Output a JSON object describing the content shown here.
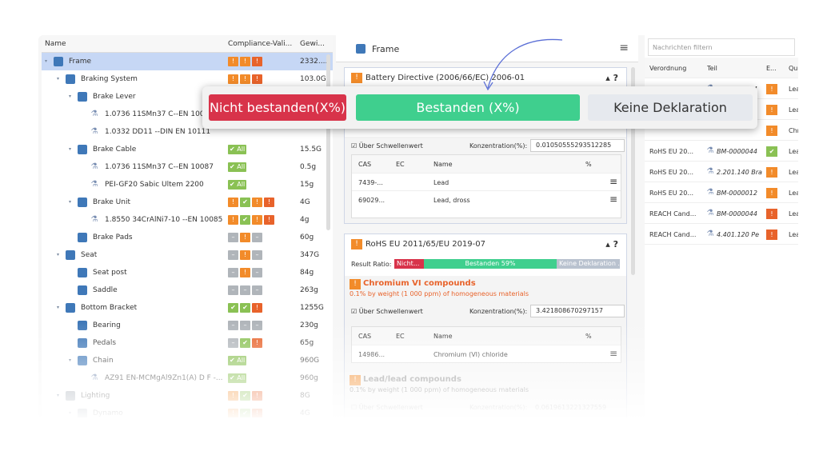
{
  "tree": {
    "headers": {
      "name": "Name",
      "compliance": "Compliance-Vali...",
      "weight": "Gewi..."
    },
    "rows": [
      {
        "label": "Frame",
        "weight": "2332....",
        "chips": [
          {
            "t": "w",
            "s": "!"
          },
          {
            "t": "w",
            "s": "!"
          },
          {
            "t": "e",
            "s": "!"
          }
        ],
        "indent": 0,
        "icon": "cube",
        "exp": "▾",
        "sel": true
      },
      {
        "label": "Braking System",
        "weight": "103.0G",
        "chips": [
          {
            "t": "w",
            "s": "!"
          },
          {
            "t": "w",
            "s": "!"
          },
          {
            "t": "e",
            "s": "!"
          }
        ],
        "indent": 1,
        "icon": "cube",
        "exp": "▾"
      },
      {
        "label": "Brake Lever",
        "weight": "",
        "chips": [],
        "indent": 2,
        "icon": "cube",
        "exp": "▾"
      },
      {
        "label": "1.0736 11SMn37 C--EN 10087",
        "weight": "",
        "chips": [],
        "indent": 3,
        "icon": "flask"
      },
      {
        "label": "1.0332 DD11 --DIN EN 10111",
        "weight": "",
        "chips": [],
        "indent": 3,
        "icon": "flask"
      },
      {
        "label": "Brake Cable",
        "weight": "15.5G",
        "chips": [
          {
            "t": "g",
            "s": "✔ All"
          }
        ],
        "indent": 2,
        "icon": "cube",
        "exp": "▾"
      },
      {
        "label": "1.0736 11SMn37 C--EN 10087",
        "weight": "0.5g",
        "chips": [
          {
            "t": "g",
            "s": "✔ All"
          }
        ],
        "indent": 3,
        "icon": "flask"
      },
      {
        "label": "PEI-GF20 Sabic Ultem 2200",
        "weight": "15g",
        "chips": [
          {
            "t": "g",
            "s": "✔ All"
          }
        ],
        "indent": 3,
        "icon": "flask"
      },
      {
        "label": "Brake Unit",
        "weight": "4G",
        "chips": [
          {
            "t": "w",
            "s": "!"
          },
          {
            "t": "g",
            "s": "✔"
          },
          {
            "t": "w",
            "s": "!"
          },
          {
            "t": "e",
            "s": "!"
          }
        ],
        "indent": 2,
        "icon": "cube",
        "exp": "▾"
      },
      {
        "label": "1.8550 34CrAlNi7-10 --EN 10085",
        "weight": "4g",
        "chips": [
          {
            "t": "w",
            "s": "!"
          },
          {
            "t": "g",
            "s": "✔"
          },
          {
            "t": "w",
            "s": "!"
          },
          {
            "t": "e",
            "s": "!"
          }
        ],
        "indent": 3,
        "icon": "flask"
      },
      {
        "label": "Brake Pads",
        "weight": "60g",
        "chips": [
          {
            "t": "n",
            "s": "–"
          },
          {
            "t": "w",
            "s": "!"
          },
          {
            "t": "n",
            "s": "–"
          }
        ],
        "indent": 2,
        "icon": "cube"
      },
      {
        "label": "Seat",
        "weight": "347G",
        "chips": [
          {
            "t": "n",
            "s": "–"
          },
          {
            "t": "w",
            "s": "!"
          },
          {
            "t": "n",
            "s": "–"
          }
        ],
        "indent": 1,
        "icon": "cube",
        "exp": "▾"
      },
      {
        "label": "Seat post",
        "weight": "84g",
        "chips": [
          {
            "t": "n",
            "s": "–"
          },
          {
            "t": "w",
            "s": "!"
          },
          {
            "t": "n",
            "s": "–"
          }
        ],
        "indent": 2,
        "icon": "cube"
      },
      {
        "label": "Saddle",
        "weight": "263g",
        "chips": [
          {
            "t": "n",
            "s": "–"
          },
          {
            "t": "n",
            "s": "–"
          },
          {
            "t": "n",
            "s": "–"
          }
        ],
        "indent": 2,
        "icon": "cube"
      },
      {
        "label": "Bottom Bracket",
        "weight": "1255G",
        "chips": [
          {
            "t": "g",
            "s": "✔"
          },
          {
            "t": "g",
            "s": "✔"
          },
          {
            "t": "e",
            "s": "!"
          }
        ],
        "indent": 1,
        "icon": "cube",
        "exp": "▾"
      },
      {
        "label": "Bearing",
        "weight": "230g",
        "chips": [
          {
            "t": "n",
            "s": "–"
          },
          {
            "t": "n",
            "s": "–"
          },
          {
            "t": "n",
            "s": "–"
          }
        ],
        "indent": 2,
        "icon": "cube"
      },
      {
        "label": "Pedals",
        "weight": "65g",
        "chips": [
          {
            "t": "n",
            "s": "–"
          },
          {
            "t": "g",
            "s": "✔"
          },
          {
            "t": "e",
            "s": "!"
          }
        ],
        "indent": 2,
        "icon": "cube"
      },
      {
        "label": "Chain",
        "weight": "960G",
        "chips": [
          {
            "t": "g",
            "s": "✔ All"
          }
        ],
        "indent": 2,
        "icon": "cube",
        "exp": "▾"
      },
      {
        "label": "AZ91 EN-MCMgAl9Zn1(A) D F -...",
        "weight": "960g",
        "chips": [
          {
            "t": "g",
            "s": "✔ All"
          }
        ],
        "indent": 3,
        "icon": "flask"
      },
      {
        "label": "Lighting",
        "weight": "8G",
        "chips": [
          {
            "t": "w",
            "s": "!"
          },
          {
            "t": "g",
            "s": "✔"
          },
          {
            "t": "e",
            "s": "!"
          }
        ],
        "indent": 1,
        "icon": "gray",
        "exp": "▾"
      },
      {
        "label": "Dynamo",
        "weight": "4G",
        "chips": [
          {
            "t": "w",
            "s": "!"
          },
          {
            "t": "g",
            "s": "✔"
          },
          {
            "t": "e",
            "s": "!"
          }
        ],
        "indent": 2,
        "icon": "gray",
        "exp": "▾"
      }
    ]
  },
  "middle": {
    "title": "Frame",
    "card1": {
      "title": "Battery Directive (2006/66/EC) 2006-01",
      "threshold": "Über Schwellenwert",
      "conc_label": "Konzentration(%):",
      "conc_value": "0.01050555293512285",
      "cols": [
        "CAS",
        "EC",
        "Name",
        "%"
      ],
      "rows": [
        {
          "cas": "7439-...",
          "ec": "",
          "name": "Lead"
        },
        {
          "cas": "69029...",
          "ec": "",
          "name": "Lead, dross"
        }
      ]
    },
    "card2": {
      "title": "RoHS EU 2011/65/EU 2019-07",
      "ratio_label": "Result Ratio:",
      "bar_fail": "Nicht...",
      "bar_pass": "Bestanden 59%",
      "bar_none": "Keine Deklaration ...",
      "pass_fraction": 0.59,
      "substance": "Chromium VI compounds",
      "substance_note": "0.1% by weight (1 000 ppm) of homogeneous materials",
      "threshold": "Über Schwellenwert",
      "conc_label": "Konzentration(%):",
      "conc_value": "3.421808670297157",
      "cols": [
        "CAS",
        "EC",
        "Name",
        "%"
      ],
      "row": {
        "cas": "14986...",
        "ec": "",
        "name": "Chromium (VI) chloride"
      },
      "substance2": "Lead/lead compounds",
      "substance2_note": "0.1% by weight (1 000 ppm) of homogeneous materials",
      "threshold2": "Über Schwellenwert",
      "conc2_value": "0.0619613221327559"
    }
  },
  "right": {
    "filter_placeholder": "Nachrichten filtern",
    "headers": [
      "Verordnung",
      "Teil",
      "E...",
      "Qu"
    ],
    "rows": [
      {
        "reg": "Battery Dire...",
        "part": "BM-0000044",
        "st": "w",
        "q": "Lea"
      },
      {
        "reg": "",
        "part": "",
        "st": "w",
        "q": "Lea"
      },
      {
        "reg": "",
        "part": "",
        "st": "w",
        "q": "Chr"
      },
      {
        "reg": "RoHS EU 20...",
        "part": "BM-0000044",
        "st": "g",
        "q": "Lea"
      },
      {
        "reg": "RoHS EU 20...",
        "part": "2.201.140 Bra",
        "st": "w",
        "q": "Lea"
      },
      {
        "reg": "RoHS EU 20...",
        "part": "BM-0000012",
        "st": "w",
        "q": "Lea"
      },
      {
        "reg": "REACH Cand...",
        "part": "BM-0000044",
        "st": "e",
        "q": "Lea"
      },
      {
        "reg": "REACH Cand...",
        "part": "4.401.120 Pe",
        "st": "e",
        "q": "Lea"
      }
    ]
  },
  "legend": {
    "fail": "Nicht bestanden(X%)",
    "pass": "Bestanden (X%)",
    "none": "Keine Deklaration"
  },
  "colors": {
    "fail": "#d8334a",
    "pass": "#3fcf8e",
    "none": "#e6e9ee",
    "warn": "#f28b2a",
    "error": "#e8632b",
    "ok": "#8ac154",
    "select": "#c6d7f5"
  }
}
